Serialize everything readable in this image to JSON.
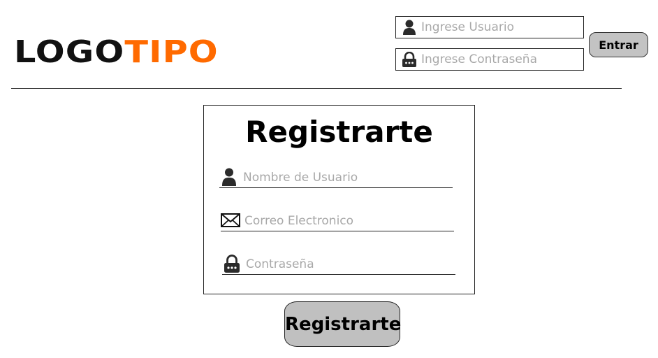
{
  "header": {
    "logo": {
      "part_a": "LOGO",
      "part_b": "TIPO",
      "color_a": "#111111",
      "color_b": "#ff6a00"
    },
    "login": {
      "user_placeholder": "Ingrese Usuario",
      "password_placeholder": "Ingrese Contraseña",
      "submit_label": "Entrar"
    }
  },
  "register": {
    "title": "Registrarte",
    "fields": {
      "username_placeholder": "Nombre de Usuario",
      "email_placeholder": "Correo Electronico",
      "password_placeholder": "Contraseña"
    },
    "submit_label": "Registrarte"
  },
  "icons": [
    "user-icon",
    "lock-icon",
    "envelope-icon"
  ],
  "colors": {
    "button_bg": "#c0c0c0",
    "accent": "#ff6a00"
  }
}
